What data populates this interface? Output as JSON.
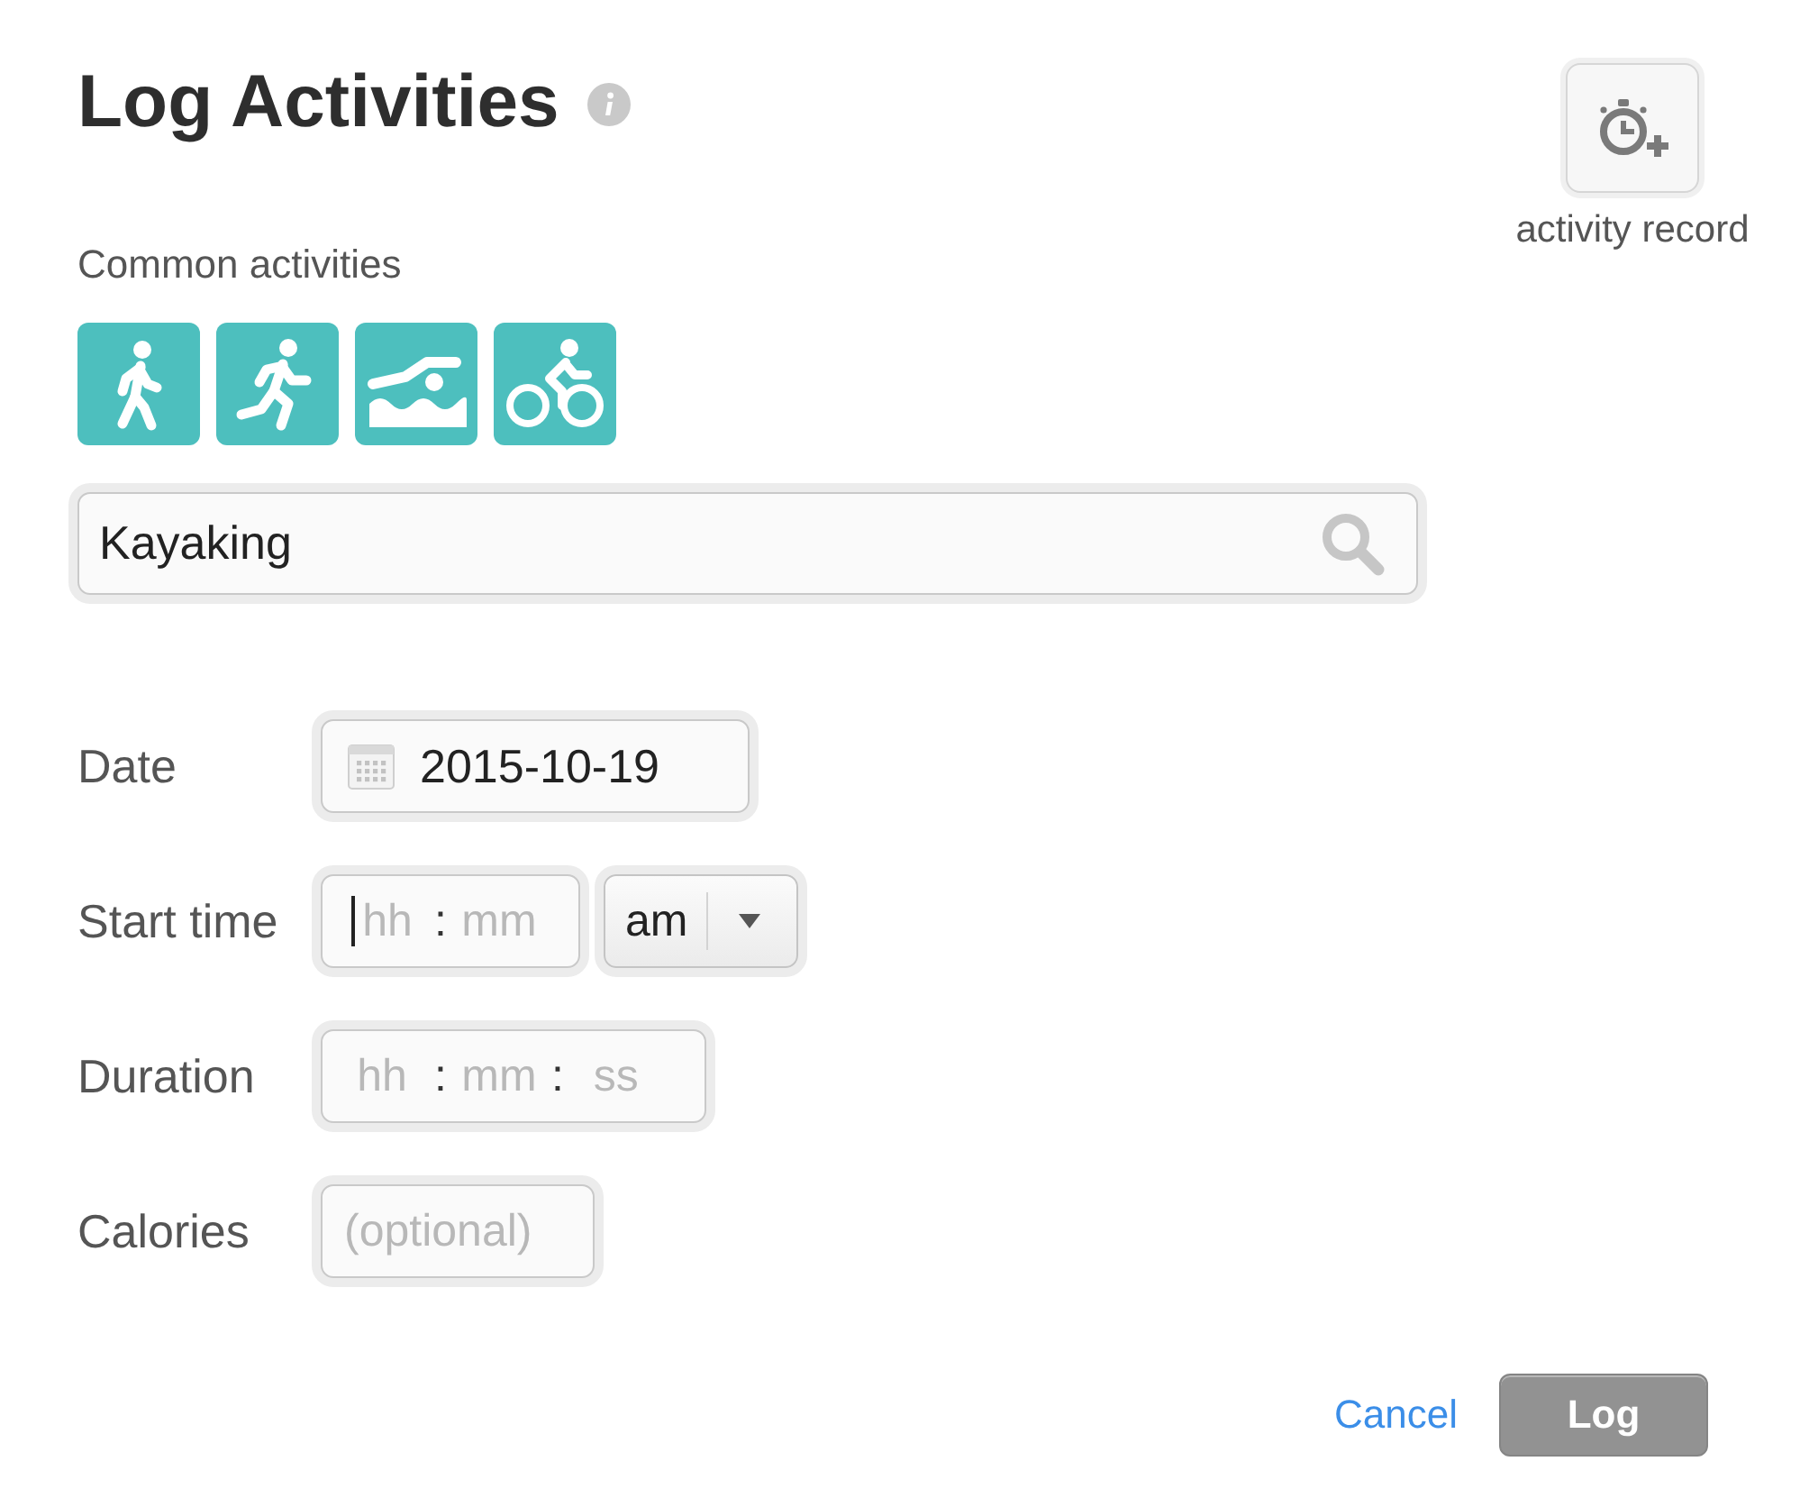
{
  "header": {
    "title": "Log Activities"
  },
  "record": {
    "label": "activity record"
  },
  "common_activities": {
    "label": "Common activities",
    "items": [
      {
        "kind": "walk"
      },
      {
        "kind": "run"
      },
      {
        "kind": "swim"
      },
      {
        "kind": "bike"
      }
    ]
  },
  "search": {
    "value": "Kayaking"
  },
  "form": {
    "fields": [
      {
        "kind": "date",
        "label": "Date",
        "value": "2015-10-19"
      },
      {
        "kind": "time",
        "label": "Start time",
        "separator": ":",
        "segments": [
          {
            "placeholder": "hh",
            "focused": true
          },
          {
            "placeholder": "mm",
            "focused": false
          }
        ],
        "period": {
          "value": "am"
        }
      },
      {
        "kind": "duration",
        "label": "Duration",
        "separator": ":",
        "segments": [
          {
            "placeholder": "hh",
            "focused": false
          },
          {
            "placeholder": "mm",
            "focused": false
          },
          {
            "placeholder": "ss",
            "focused": false
          }
        ]
      },
      {
        "kind": "number",
        "label": "Calories",
        "placeholder": "(optional)"
      }
    ]
  },
  "actions": {
    "cancel": {
      "label": "Cancel"
    },
    "submit": {
      "label": "Log",
      "disabled": true
    }
  }
}
